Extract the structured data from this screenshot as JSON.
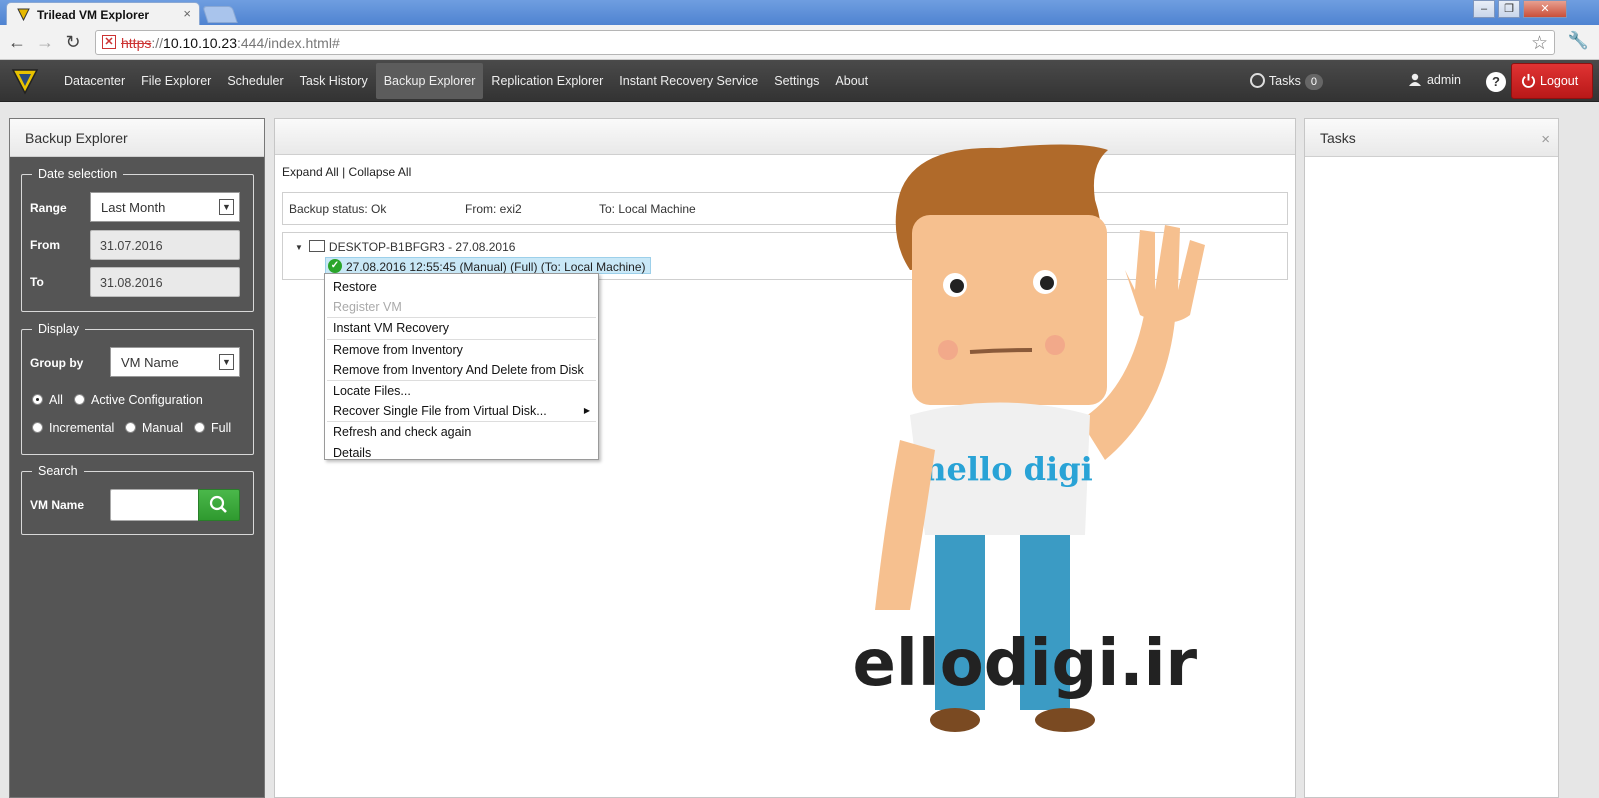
{
  "browser": {
    "tab_title": "Trilead VM Explorer",
    "tab_close": "×",
    "url_protocol": "https",
    "url_sep": "://",
    "url_host": "10.10.10.23",
    "url_rest": ":444/index.html#",
    "win_min": "–",
    "win_max": "❐",
    "win_close": "✕"
  },
  "nav": {
    "items": [
      {
        "label": "Datacenter"
      },
      {
        "label": "File Explorer"
      },
      {
        "label": "Scheduler"
      },
      {
        "label": "Task History"
      },
      {
        "label": "Backup Explorer",
        "active": true
      },
      {
        "label": "Replication Explorer"
      },
      {
        "label": "Instant Recovery Service"
      },
      {
        "label": "Settings"
      },
      {
        "label": "About"
      }
    ],
    "tasks_label": "Tasks",
    "tasks_count": "0",
    "user_label": "admin",
    "help_label": "?",
    "logout_label": "Logout"
  },
  "left_panel": {
    "title": "Backup Explorer",
    "date_selection": {
      "legend": "Date selection",
      "range_label": "Range",
      "range_value": "Last Month",
      "from_label": "From",
      "from_value": "31.07.2016",
      "to_label": "To",
      "to_value": "31.08.2016"
    },
    "display": {
      "legend": "Display",
      "group_by_label": "Group by",
      "group_by_value": "VM Name",
      "radios": [
        {
          "label": "All",
          "checked": true
        },
        {
          "label": "Active Configuration",
          "checked": false
        },
        {
          "label": "Incremental",
          "checked": false
        },
        {
          "label": "Manual",
          "checked": false
        },
        {
          "label": "Full",
          "checked": false
        }
      ]
    },
    "search": {
      "legend": "Search",
      "vm_name_label": "VM Name",
      "vm_name_value": ""
    }
  },
  "center_panel": {
    "expand_all": "Expand All",
    "separator": "|",
    "collapse_all": "Collapse All",
    "status": {
      "backup_status": "Backup status: Ok",
      "from": "From: exi2",
      "to": "To: Local Machine"
    },
    "tree": {
      "node_label": "DESKTOP-B1BFGR3 - 27.08.2016",
      "child_label": "27.08.2016 12:55:45 (Manual) (Full) (To: Local Machine)"
    },
    "context_menu": [
      {
        "label": "Restore",
        "disabled": false
      },
      {
        "label": "Register VM",
        "disabled": true
      },
      {
        "label": "Instant VM Recovery",
        "disabled": false
      },
      {
        "label": "Remove from Inventory",
        "disabled": false
      },
      {
        "label": "Remove from Inventory And Delete from Disk",
        "disabled": false
      },
      {
        "label": "Locate Files...",
        "disabled": false
      },
      {
        "label": "Recover Single File from Virtual Disk...",
        "disabled": false,
        "submenu": true
      },
      {
        "label": "Refresh and check again",
        "disabled": false
      },
      {
        "label": "Details",
        "disabled": false
      }
    ]
  },
  "right_panel": {
    "title": "Tasks",
    "close": "×"
  },
  "watermark": {
    "shirt_text": "hello digi",
    "site_text": "hellodigi.ir"
  },
  "colors": {
    "nav_bg": "#3c3c3c",
    "logout": "#d42525",
    "selection": "#c9e8f7",
    "success": "#2aa52a"
  }
}
